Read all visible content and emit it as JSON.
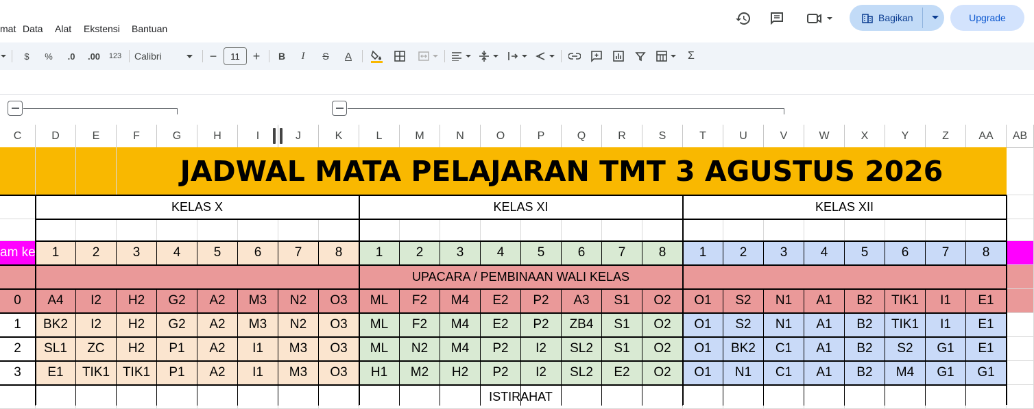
{
  "menu": {
    "items": [
      "mat",
      "Data",
      "Alat",
      "Ekstensi",
      "Bantuan"
    ]
  },
  "header": {
    "share_label": "Bagikan",
    "upgrade_label": "Upgrade"
  },
  "toolbar": {
    "currency": "$",
    "percent": "%",
    "dec_less": ".0",
    "dec_more": ".00",
    "number_format": "123",
    "font_name": "Calibri",
    "font_size": "11",
    "minus": "−",
    "plus": "+",
    "bold": "B",
    "italic": "I",
    "strike": "S",
    "underline_a": "A",
    "sum": "Σ"
  },
  "columns": [
    "C",
    "D",
    "E",
    "F",
    "G",
    "H",
    "I",
    "J",
    "K",
    "L",
    "M",
    "N",
    "O",
    "P",
    "Q",
    "R",
    "S",
    "T",
    "U",
    "V",
    "W",
    "X",
    "Y",
    "Z",
    "AA",
    "AB"
  ],
  "sheet": {
    "title": "JADWAL MATA PELAJARAN TMT 3 AGUSTUS 2026",
    "kelas": [
      "KELAS X",
      "KELAS XI",
      "KELAS XII"
    ],
    "jam_label": "am ke",
    "period_numbers": [
      "1",
      "2",
      "3",
      "4",
      "5",
      "6",
      "7",
      "8"
    ],
    "upacara": "UPACARA / PEMBINAAN WALI KELAS",
    "istirahat": "ISTIRAHAT",
    "rows": [
      {
        "jam": "0",
        "cells": [
          "A4",
          "I2",
          "H2",
          "G2",
          "A2",
          "M3",
          "N2",
          "O3",
          "ML",
          "F2",
          "M4",
          "E2",
          "P2",
          "A3",
          "S1",
          "O2",
          "O1",
          "S2",
          "N1",
          "A1",
          "B2",
          "TIK1",
          "I1",
          "E1"
        ]
      },
      {
        "jam": "1",
        "cells": [
          "BK2",
          "I2",
          "H2",
          "G2",
          "A2",
          "M3",
          "N2",
          "O3",
          "ML",
          "F2",
          "M4",
          "E2",
          "P2",
          "ZB4",
          "S1",
          "O2",
          "O1",
          "S2",
          "N1",
          "A1",
          "B2",
          "TIK1",
          "I1",
          "E1"
        ]
      },
      {
        "jam": "2",
        "cells": [
          "SL1",
          "ZC",
          "H2",
          "P1",
          "A2",
          "I1",
          "M3",
          "O3",
          "ML",
          "N2",
          "M4",
          "P2",
          "I2",
          "SL2",
          "S1",
          "O2",
          "O1",
          "BK2",
          "C1",
          "A1",
          "B2",
          "S2",
          "G1",
          "E1"
        ]
      },
      {
        "jam": "3",
        "cells": [
          "E1",
          "TIK1",
          "TIK1",
          "P1",
          "A2",
          "I1",
          "M3",
          "O3",
          "H1",
          "M2",
          "H2",
          "P2",
          "I2",
          "SL2",
          "E2",
          "O2",
          "O1",
          "N1",
          "C1",
          "A1",
          "B2",
          "M4",
          "G1",
          "G1"
        ]
      }
    ]
  },
  "colors": {
    "title_bg": "#f9b800",
    "x_bg": "#fbe5cf",
    "xi_bg": "#d9ead3",
    "xii_bg": "#c9daf8",
    "pink_bg": "#ea9999",
    "magenta": "#ff00ff",
    "toolbar_bg": "#f0f4f9",
    "share_bg": "#c2dbf7"
  }
}
